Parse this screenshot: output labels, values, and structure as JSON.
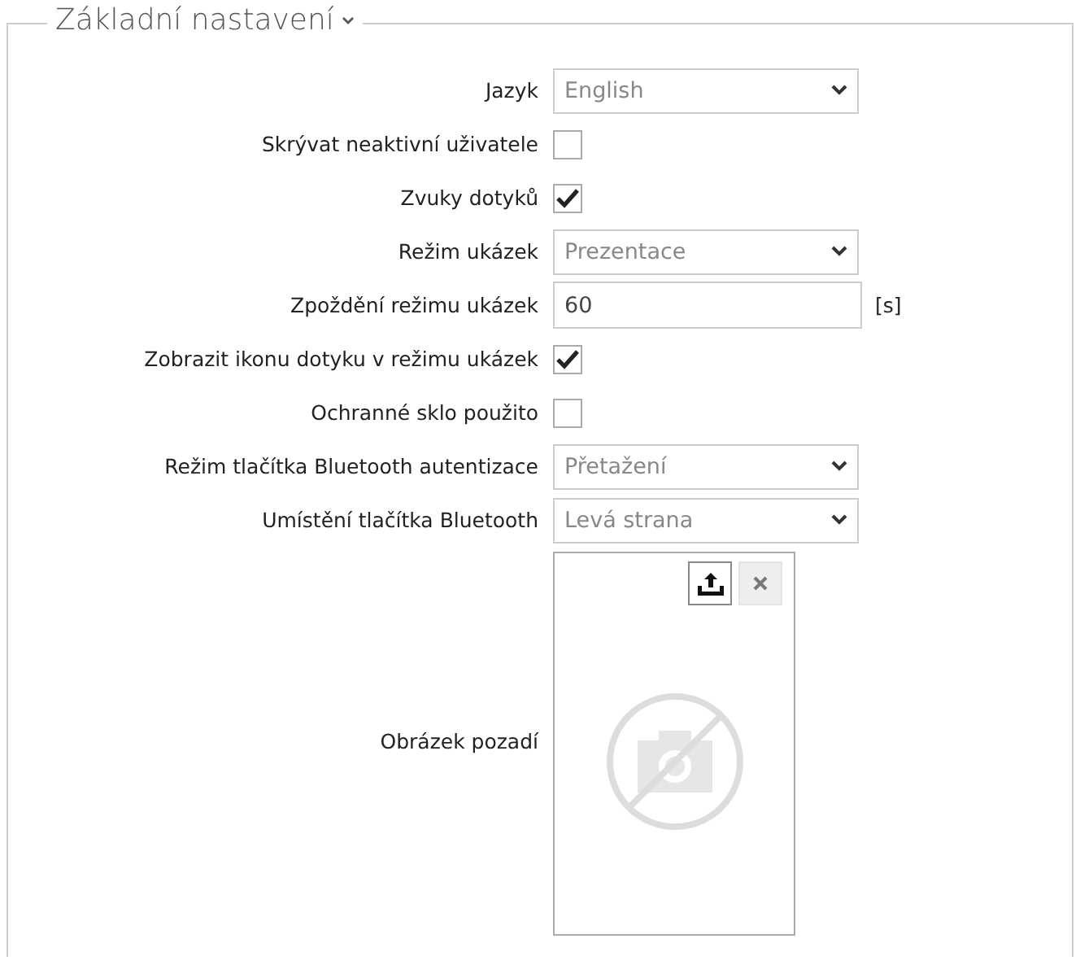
{
  "section": {
    "title": "Základní nastavení",
    "expanded": true
  },
  "rows": [
    {
      "kind": "select",
      "label": "Jazyk",
      "value": "English"
    },
    {
      "kind": "checkbox",
      "label": "Skrývat neaktivní uživatele",
      "checked": false
    },
    {
      "kind": "checkbox",
      "label": "Zvuky dotyků",
      "checked": true
    },
    {
      "kind": "select",
      "label": "Režim ukázek",
      "value": "Prezentace"
    },
    {
      "kind": "text",
      "label": "Zpoždění režimu ukázek",
      "value": "60",
      "unit": "[s]"
    },
    {
      "kind": "checkbox",
      "label": "Zobrazit ikonu dotyku v režimu ukázek",
      "checked": true
    },
    {
      "kind": "checkbox",
      "label": "Ochranné sklo použito",
      "checked": false
    },
    {
      "kind": "select",
      "label": "Režim tlačítka Bluetooth autentizace",
      "value": "Přetažení"
    },
    {
      "kind": "select",
      "label": "Umístění tlačítka Bluetooth",
      "value": "Levá strana"
    },
    {
      "kind": "image",
      "label": "Obrázek pozadí"
    }
  ]
}
